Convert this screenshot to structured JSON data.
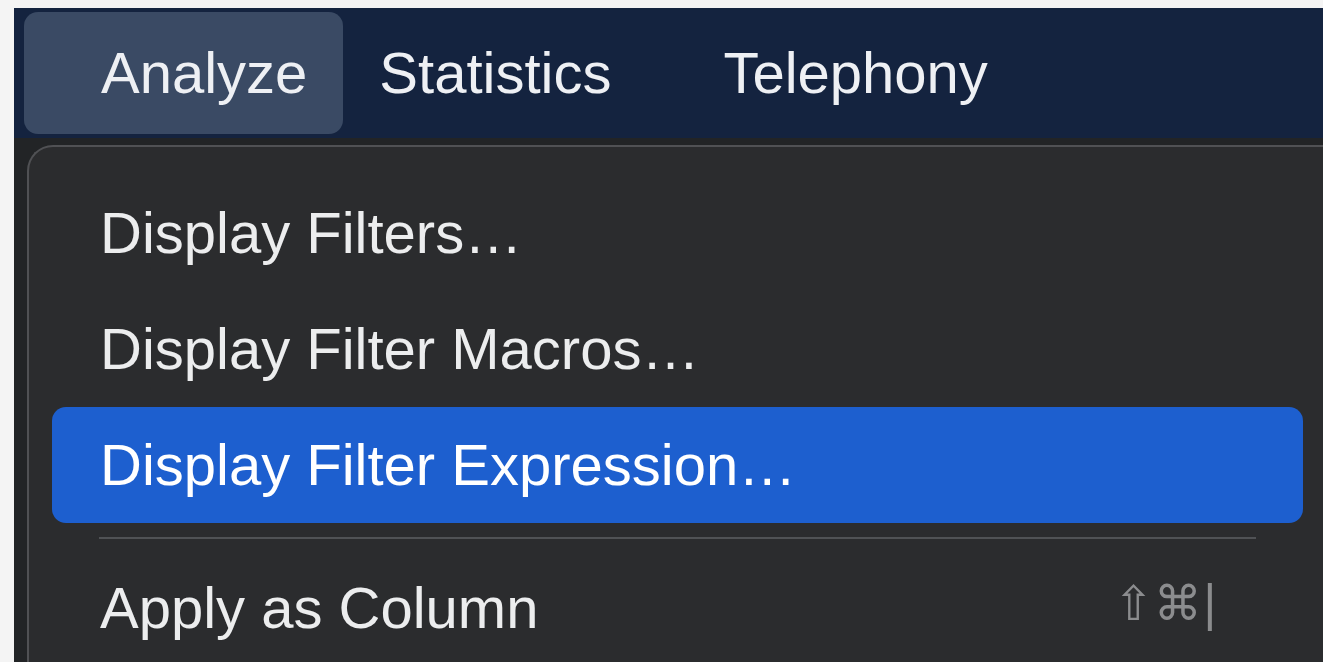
{
  "menu_bar": [
    {
      "label": "Analyze",
      "selected": true
    },
    {
      "label": "Statistics",
      "selected": false
    },
    {
      "label": "Telephony",
      "selected": false
    }
  ],
  "menu": {
    "items": [
      {
        "kind": "item",
        "label": "Display Filters…",
        "selected": false
      },
      {
        "kind": "item",
        "label": "Display Filter Macros…",
        "selected": false
      },
      {
        "kind": "item",
        "label": "Display Filter Expression…",
        "selected": true
      },
      {
        "kind": "separator"
      },
      {
        "kind": "item",
        "label": "Apply as Column",
        "shortcut": "⇧⌘|",
        "selected": false
      }
    ]
  }
}
